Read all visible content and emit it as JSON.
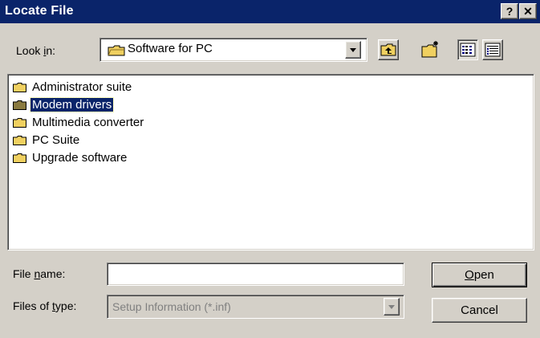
{
  "window": {
    "title": "Locate File",
    "help_label": "?",
    "close_label": "✕"
  },
  "look_in": {
    "label_pre": "Look ",
    "label_accel": "i",
    "label_post": "n:",
    "value": "Software for PC"
  },
  "toolbar": {
    "up_icon": "up-one-level-icon",
    "new_folder_icon": "new-folder-icon",
    "list_icon": "list-view-icon",
    "details_icon": "details-view-icon"
  },
  "files": [
    {
      "name": "Administrator suite",
      "selected": false
    },
    {
      "name": "Modem drivers",
      "selected": true
    },
    {
      "name": "Multimedia converter",
      "selected": false
    },
    {
      "name": "PC Suite",
      "selected": false
    },
    {
      "name": "Upgrade software",
      "selected": false
    }
  ],
  "file_name": {
    "label_pre": "File ",
    "label_accel": "n",
    "label_post": "ame:",
    "value": ""
  },
  "file_type": {
    "label_pre": "Files of ",
    "label_accel": "t",
    "label_post": "ype:",
    "value": "Setup Information (*.inf)"
  },
  "buttons": {
    "open_accel": "O",
    "open_rest": "pen",
    "cancel": "Cancel"
  },
  "colors": {
    "titlebar": "#0a246a",
    "face": "#d4d0c8",
    "folder": "#f0d060",
    "selection": "#0a246a"
  }
}
